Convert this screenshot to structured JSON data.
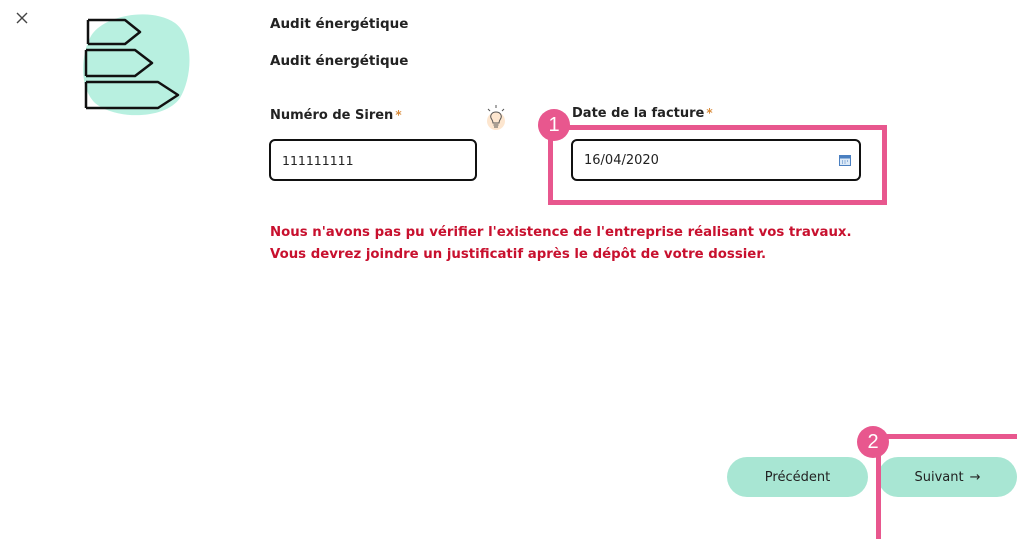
{
  "form": {
    "title": "Audit énergétique",
    "subtitle": "Audit énergétique",
    "siren": {
      "label": "Numéro de Siren",
      "required_mark": "*",
      "value": "111111111"
    },
    "invoice_date": {
      "label": "Date de la facture",
      "required_mark": "*",
      "value": "16/04/2020"
    },
    "errors": [
      "Nous n'avons pas pu vérifier l'existence de l'entreprise réalisant vos travaux.",
      "Vous devrez joindre un justificatif après le dépôt de votre dossier."
    ]
  },
  "navigation": {
    "previous_label": "Précédent",
    "next_label": "Suivant",
    "next_arrow": "→"
  },
  "annotations": {
    "badge_1": "1",
    "badge_2": "2"
  },
  "icons": [
    "close-icon",
    "signpost-illustration",
    "lightbulb-icon",
    "calendar-icon",
    "arrow-right-icon"
  ],
  "colors": {
    "accent_highlight": "#e8578e",
    "button_bg": "#a8e6d3",
    "error_text": "#c8102e",
    "required_star": "#d98b3a",
    "illustration_blob": "#b8f0e0"
  }
}
